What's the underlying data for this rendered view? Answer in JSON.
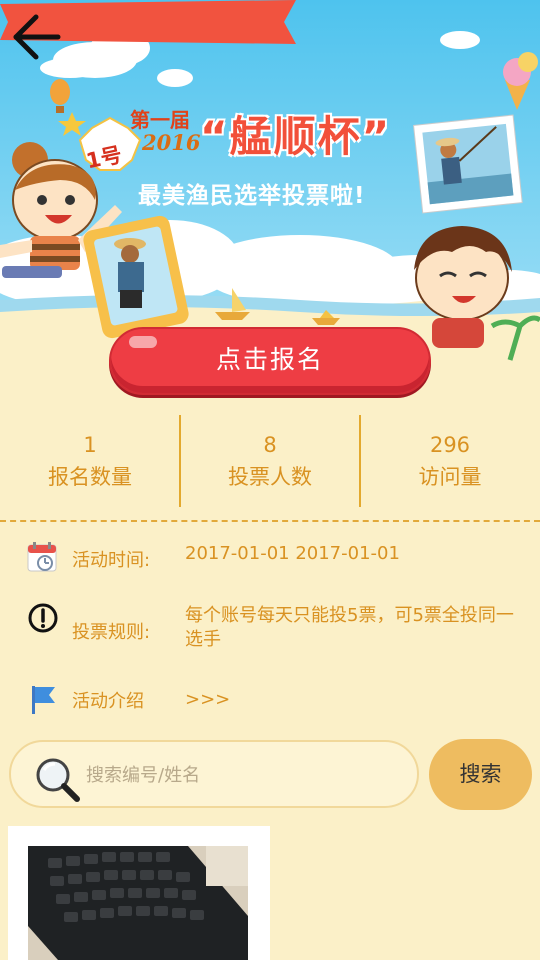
{
  "header": {
    "back_icon": "arrow-left-icon"
  },
  "banner": {
    "title_prefix": "第一届",
    "year": "2016",
    "cup_name": "“艋顺杯”",
    "subtitle": "最美渔民选举投票啦!",
    "badge": "1号"
  },
  "signup": {
    "label": "点击报名"
  },
  "stats": [
    {
      "value": "1",
      "label": "报名数量"
    },
    {
      "value": "8",
      "label": "投票人数"
    },
    {
      "value": "296",
      "label": "访问量"
    }
  ],
  "info": {
    "time": {
      "label": "活动时间:",
      "value": "2017-01-01  2017-01-01",
      "icon": "calendar-clock-icon"
    },
    "rules": {
      "label": "投票规则:",
      "value": "每个账号每天只能投5票，可5票全投同一选手",
      "icon": "exclamation-circle-icon"
    },
    "intro": {
      "label": "活动介绍",
      "value": ">>>",
      "icon": "flag-icon"
    }
  },
  "search": {
    "placeholder": "搜索编号/姓名",
    "button_label": "搜索",
    "icon": "magnifier-icon"
  },
  "colors": {
    "accent_text": "#d99222",
    "signup_red": "#ee3d44",
    "search_button": "#eebc60",
    "page_bg": "#fbf0c8",
    "sky": "#5cc6ec"
  }
}
